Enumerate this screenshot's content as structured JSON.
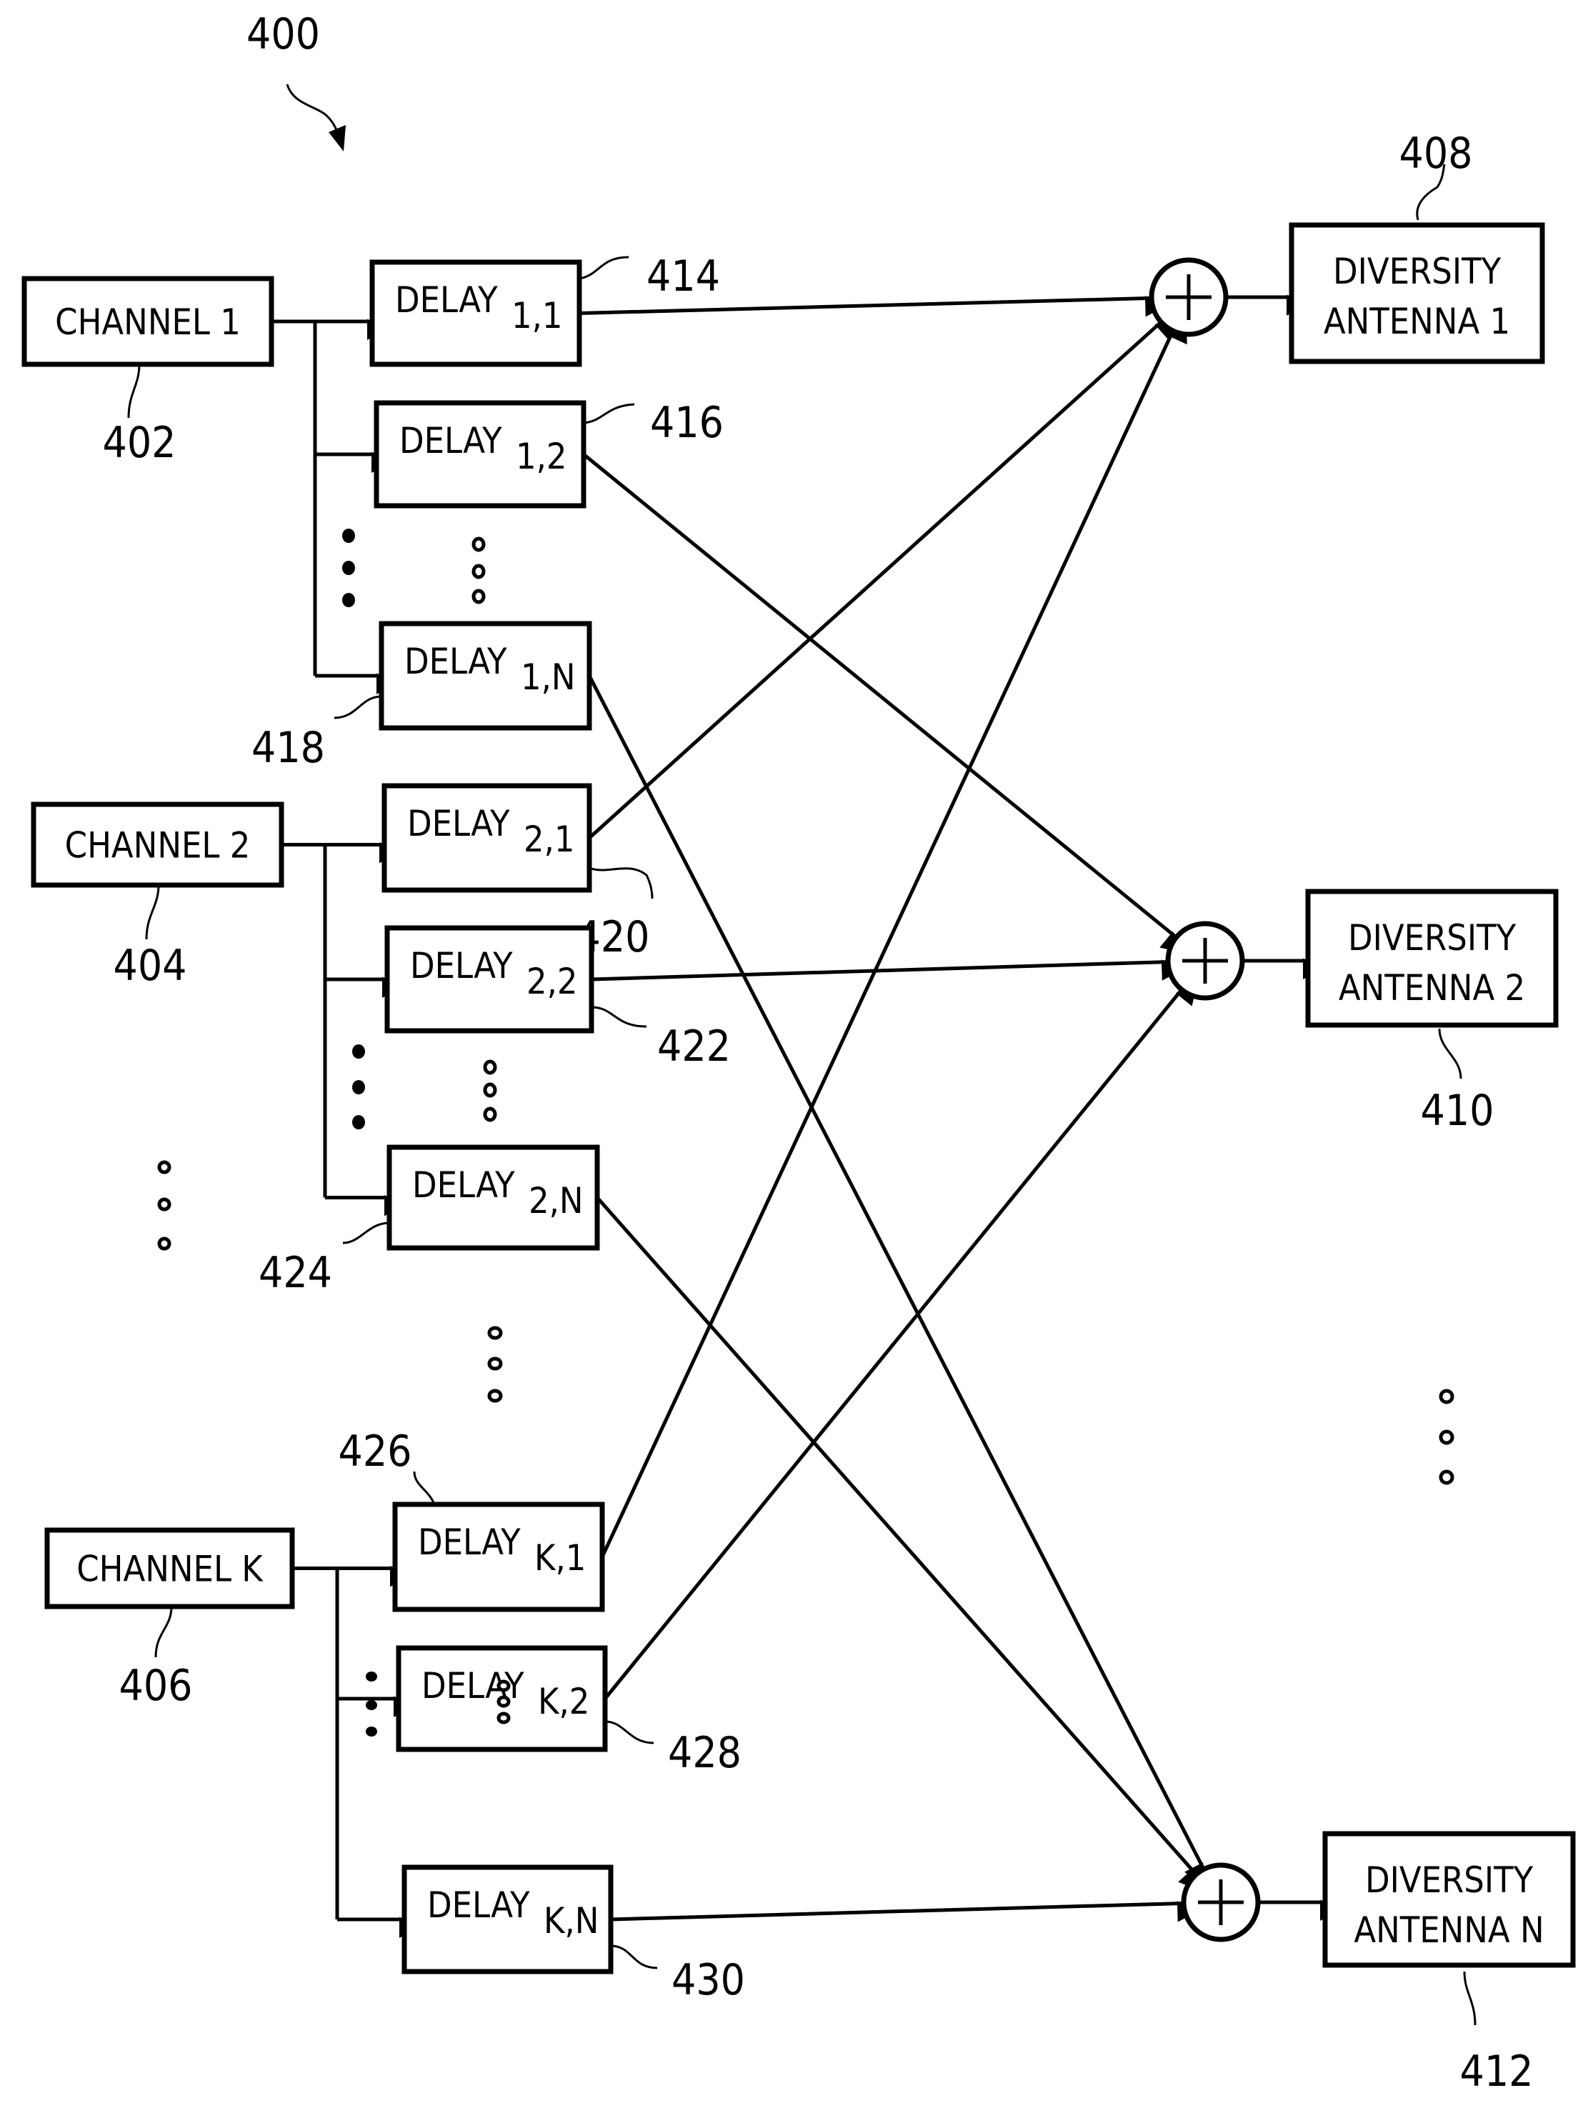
{
  "figure": {
    "number": "400",
    "colors": {
      "ink": "#000000",
      "paper": "#ffffff"
    }
  },
  "channels": [
    {
      "id": "ch1",
      "label": "CHANNEL 1",
      "ref": "402"
    },
    {
      "id": "ch2",
      "label": "CHANNEL 2",
      "ref": "404"
    },
    {
      "id": "chK",
      "label": "CHANNEL K",
      "ref": "406"
    }
  ],
  "delays": [
    {
      "id": "d11",
      "label": "DELAY",
      "sub": "1,1",
      "ref": "414"
    },
    {
      "id": "d12",
      "label": "DELAY",
      "sub": "1,2",
      "ref": "416"
    },
    {
      "id": "d1N",
      "label": "DELAY",
      "sub": "1,N",
      "ref": "418"
    },
    {
      "id": "d21",
      "label": "DELAY",
      "sub": "2,1",
      "ref": "420"
    },
    {
      "id": "d22",
      "label": "DELAY",
      "sub": "2,2",
      "ref": "422"
    },
    {
      "id": "d2N",
      "label": "DELAY",
      "sub": "2,N",
      "ref": "424"
    },
    {
      "id": "dK1",
      "label": "DELAY",
      "sub": "K,1",
      "ref": "426"
    },
    {
      "id": "dK2",
      "label": "DELAY",
      "sub": "K,2",
      "ref": "428"
    },
    {
      "id": "dKN",
      "label": "DELAY",
      "sub": "K,N",
      "ref": "430"
    }
  ],
  "summers": [
    {
      "id": "s1",
      "symbol": "+"
    },
    {
      "id": "s2",
      "symbol": "+"
    },
    {
      "id": "sN",
      "symbol": "+"
    }
  ],
  "antennas": [
    {
      "id": "a1",
      "line1": "DIVERSITY",
      "line2": "ANTENNA 1",
      "ref": "408"
    },
    {
      "id": "a2",
      "line1": "DIVERSITY",
      "line2": "ANTENNA 2",
      "ref": "410"
    },
    {
      "id": "aN",
      "line1": "DIVERSITY",
      "line2": "ANTENNA N",
      "ref": "412"
    }
  ],
  "connections": [
    {
      "from": "ch1",
      "to": "d11"
    },
    {
      "from": "ch1",
      "to": "d12"
    },
    {
      "from": "ch1",
      "to": "d1N"
    },
    {
      "from": "ch2",
      "to": "d21"
    },
    {
      "from": "ch2",
      "to": "d22"
    },
    {
      "from": "ch2",
      "to": "d2N"
    },
    {
      "from": "chK",
      "to": "dK1"
    },
    {
      "from": "chK",
      "to": "dK2"
    },
    {
      "from": "chK",
      "to": "dKN"
    },
    {
      "from": "d11",
      "to": "s1"
    },
    {
      "from": "d21",
      "to": "s1"
    },
    {
      "from": "dK1",
      "to": "s1"
    },
    {
      "from": "d12",
      "to": "s2"
    },
    {
      "from": "d22",
      "to": "s2"
    },
    {
      "from": "dK2",
      "to": "s2"
    },
    {
      "from": "d1N",
      "to": "sN"
    },
    {
      "from": "d2N",
      "to": "sN"
    },
    {
      "from": "dKN",
      "to": "sN"
    },
    {
      "from": "s1",
      "to": "a1"
    },
    {
      "from": "s2",
      "to": "a2"
    },
    {
      "from": "sN",
      "to": "aN"
    }
  ]
}
